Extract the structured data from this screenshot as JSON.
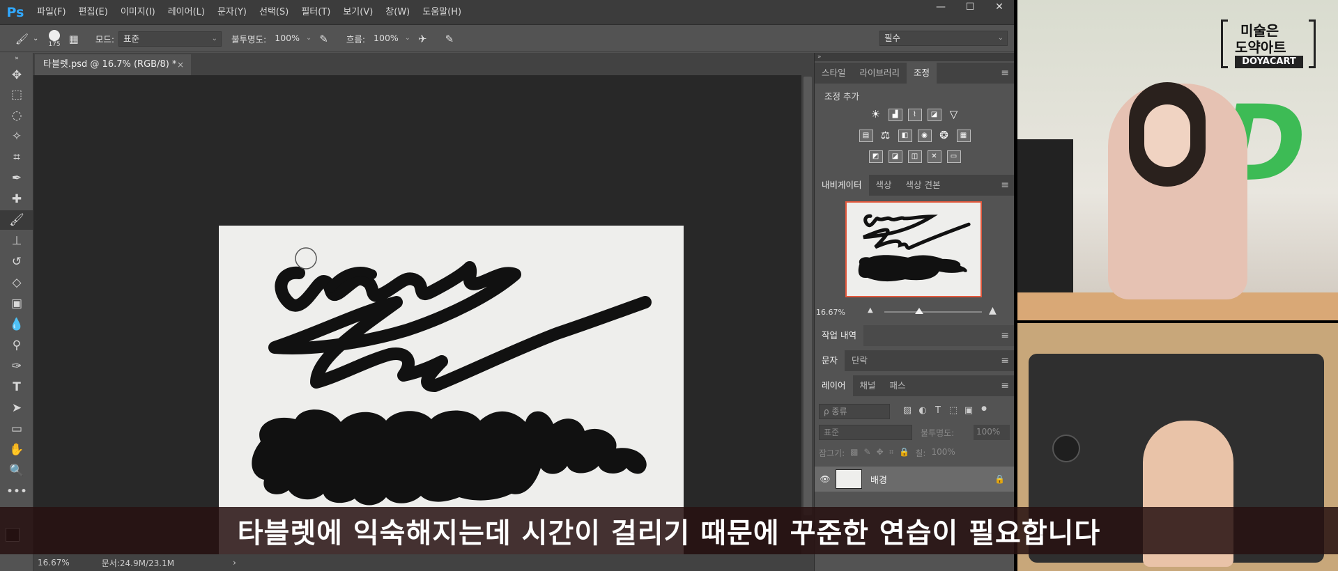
{
  "menu": {
    "logo": "Ps",
    "items": [
      "파일(F)",
      "편집(E)",
      "이미지(I)",
      "레이어(L)",
      "문자(Y)",
      "선택(S)",
      "필터(T)",
      "보기(V)",
      "창(W)",
      "도움말(H)"
    ],
    "window_controls": [
      "—",
      "☐",
      "✕"
    ]
  },
  "options": {
    "brush_size": "175",
    "mode_label": "모드:",
    "mode_value": "표준",
    "opacity_label": "불투명도:",
    "opacity_value": "100%",
    "flow_label": "흐름:",
    "flow_value": "100%",
    "workspace": "필수"
  },
  "document": {
    "tab_title": "타블렛.psd @ 16.7% (RGB/8) *",
    "close": "×"
  },
  "status": {
    "zoom": "16.67%",
    "doc_size": "문서:24.9M/23.1M",
    "arrow": "›"
  },
  "panels": {
    "top_tabs": [
      "스타일",
      "라이브러리",
      "조정"
    ],
    "adjustments_title": "조정 추가",
    "nav_tabs": [
      "내비게이터",
      "색상",
      "색상 견본"
    ],
    "nav_zoom": "16.67%",
    "history_tab": "작업 내역",
    "char_tabs": [
      "문자",
      "단락"
    ],
    "layer_tabs": [
      "레이어",
      "채널",
      "패스"
    ],
    "layer_search": "ρ 종류",
    "blend_mode": "표준",
    "layer_opacity_label": "불투명도:",
    "layer_opacity_value": "100%",
    "lock_label": "잠그기:",
    "fill_label": "칠:",
    "fill_value": "100%",
    "layer_name": "배경",
    "menu_icon": "≡"
  },
  "subtitle": "타블렛에 익숙해지는데 시간이 걸리기 때문에 꾸준한 연습이 필요합니다",
  "watermark": {
    "line1": "미술은",
    "line2": "도약아트",
    "badge": "DOYACART"
  }
}
